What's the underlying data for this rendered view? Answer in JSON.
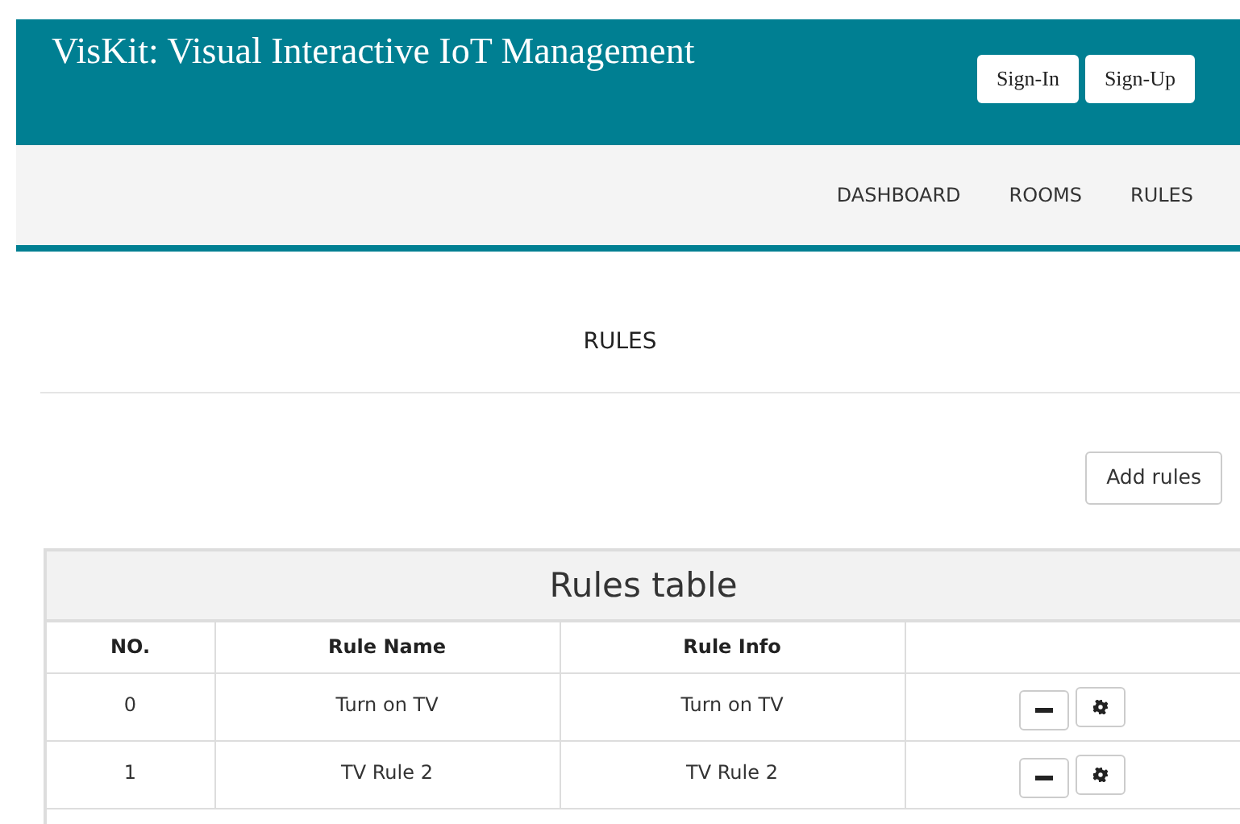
{
  "header": {
    "title": "VisKit: Visual Interactive IoT Management",
    "buttons": [
      "Sign-In",
      "Sign-Up"
    ]
  },
  "nav": {
    "items": [
      {
        "label": "DASHBOARD"
      },
      {
        "label": "ROOMS"
      },
      {
        "label": "RULES"
      }
    ]
  },
  "page_title": "RULES",
  "add_button": "Add rules",
  "table": {
    "title": "Rules table",
    "columns": [
      "NO.",
      "Rule Name",
      "Rule Info"
    ],
    "rows": [
      {
        "no": "0",
        "name": "Turn on TV",
        "info": "Turn on TV"
      },
      {
        "no": "1",
        "name": "TV Rule 2",
        "info": "TV Rule 2"
      }
    ]
  }
}
